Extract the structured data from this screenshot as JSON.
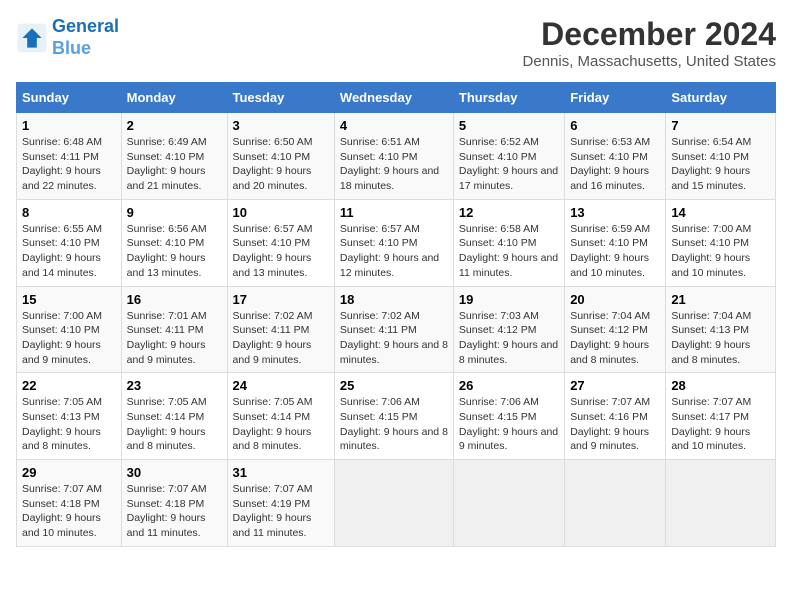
{
  "logo": {
    "line1": "General",
    "line2": "Blue"
  },
  "title": "December 2024",
  "subtitle": "Dennis, Massachusetts, United States",
  "days_header": [
    "Sunday",
    "Monday",
    "Tuesday",
    "Wednesday",
    "Thursday",
    "Friday",
    "Saturday"
  ],
  "weeks": [
    [
      {
        "day": "1",
        "sunrise": "6:48 AM",
        "sunset": "4:11 PM",
        "daylight": "9 hours and 22 minutes."
      },
      {
        "day": "2",
        "sunrise": "6:49 AM",
        "sunset": "4:10 PM",
        "daylight": "9 hours and 21 minutes."
      },
      {
        "day": "3",
        "sunrise": "6:50 AM",
        "sunset": "4:10 PM",
        "daylight": "9 hours and 20 minutes."
      },
      {
        "day": "4",
        "sunrise": "6:51 AM",
        "sunset": "4:10 PM",
        "daylight": "9 hours and 18 minutes."
      },
      {
        "day": "5",
        "sunrise": "6:52 AM",
        "sunset": "4:10 PM",
        "daylight": "9 hours and 17 minutes."
      },
      {
        "day": "6",
        "sunrise": "6:53 AM",
        "sunset": "4:10 PM",
        "daylight": "9 hours and 16 minutes."
      },
      {
        "day": "7",
        "sunrise": "6:54 AM",
        "sunset": "4:10 PM",
        "daylight": "9 hours and 15 minutes."
      }
    ],
    [
      {
        "day": "8",
        "sunrise": "6:55 AM",
        "sunset": "4:10 PM",
        "daylight": "9 hours and 14 minutes."
      },
      {
        "day": "9",
        "sunrise": "6:56 AM",
        "sunset": "4:10 PM",
        "daylight": "9 hours and 13 minutes."
      },
      {
        "day": "10",
        "sunrise": "6:57 AM",
        "sunset": "4:10 PM",
        "daylight": "9 hours and 13 minutes."
      },
      {
        "day": "11",
        "sunrise": "6:57 AM",
        "sunset": "4:10 PM",
        "daylight": "9 hours and 12 minutes."
      },
      {
        "day": "12",
        "sunrise": "6:58 AM",
        "sunset": "4:10 PM",
        "daylight": "9 hours and 11 minutes."
      },
      {
        "day": "13",
        "sunrise": "6:59 AM",
        "sunset": "4:10 PM",
        "daylight": "9 hours and 10 minutes."
      },
      {
        "day": "14",
        "sunrise": "7:00 AM",
        "sunset": "4:10 PM",
        "daylight": "9 hours and 10 minutes."
      }
    ],
    [
      {
        "day": "15",
        "sunrise": "7:00 AM",
        "sunset": "4:10 PM",
        "daylight": "9 hours and 9 minutes."
      },
      {
        "day": "16",
        "sunrise": "7:01 AM",
        "sunset": "4:11 PM",
        "daylight": "9 hours and 9 minutes."
      },
      {
        "day": "17",
        "sunrise": "7:02 AM",
        "sunset": "4:11 PM",
        "daylight": "9 hours and 9 minutes."
      },
      {
        "day": "18",
        "sunrise": "7:02 AM",
        "sunset": "4:11 PM",
        "daylight": "9 hours and 8 minutes."
      },
      {
        "day": "19",
        "sunrise": "7:03 AM",
        "sunset": "4:12 PM",
        "daylight": "9 hours and 8 minutes."
      },
      {
        "day": "20",
        "sunrise": "7:04 AM",
        "sunset": "4:12 PM",
        "daylight": "9 hours and 8 minutes."
      },
      {
        "day": "21",
        "sunrise": "7:04 AM",
        "sunset": "4:13 PM",
        "daylight": "9 hours and 8 minutes."
      }
    ],
    [
      {
        "day": "22",
        "sunrise": "7:05 AM",
        "sunset": "4:13 PM",
        "daylight": "9 hours and 8 minutes."
      },
      {
        "day": "23",
        "sunrise": "7:05 AM",
        "sunset": "4:14 PM",
        "daylight": "9 hours and 8 minutes."
      },
      {
        "day": "24",
        "sunrise": "7:05 AM",
        "sunset": "4:14 PM",
        "daylight": "9 hours and 8 minutes."
      },
      {
        "day": "25",
        "sunrise": "7:06 AM",
        "sunset": "4:15 PM",
        "daylight": "9 hours and 8 minutes."
      },
      {
        "day": "26",
        "sunrise": "7:06 AM",
        "sunset": "4:15 PM",
        "daylight": "9 hours and 9 minutes."
      },
      {
        "day": "27",
        "sunrise": "7:07 AM",
        "sunset": "4:16 PM",
        "daylight": "9 hours and 9 minutes."
      },
      {
        "day": "28",
        "sunrise": "7:07 AM",
        "sunset": "4:17 PM",
        "daylight": "9 hours and 10 minutes."
      }
    ],
    [
      {
        "day": "29",
        "sunrise": "7:07 AM",
        "sunset": "4:18 PM",
        "daylight": "9 hours and 10 minutes."
      },
      {
        "day": "30",
        "sunrise": "7:07 AM",
        "sunset": "4:18 PM",
        "daylight": "9 hours and 11 minutes."
      },
      {
        "day": "31",
        "sunrise": "7:07 AM",
        "sunset": "4:19 PM",
        "daylight": "9 hours and 11 minutes."
      },
      null,
      null,
      null,
      null
    ]
  ]
}
